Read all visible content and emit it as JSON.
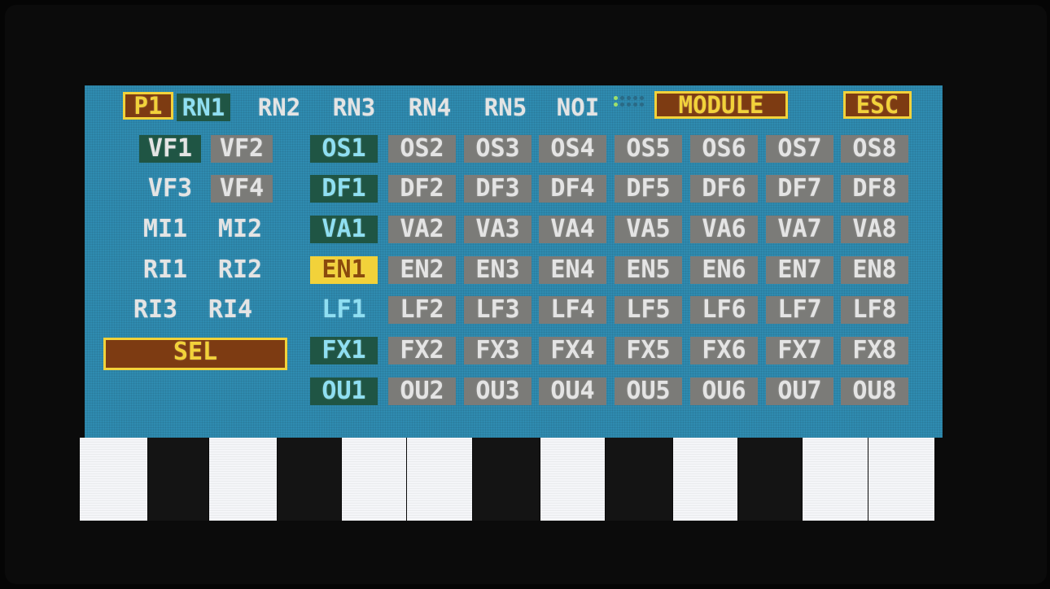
{
  "header": {
    "page": "P1",
    "tabs": [
      "RN1",
      "RN2",
      "RN3",
      "RN4",
      "RN5",
      "NOI"
    ],
    "module_button": "MODULE",
    "esc_button": "ESC"
  },
  "left_grid": [
    [
      "VF1",
      "VF2"
    ],
    [
      "VF3",
      "VF4"
    ],
    [
      "MI1",
      "MI2"
    ],
    [
      "RI1",
      "RI2"
    ],
    [
      "RI3",
      "RI4"
    ]
  ],
  "sel_button": "SEL",
  "module_grid": [
    [
      "OS1",
      "OS2",
      "OS3",
      "OS4",
      "OS5",
      "OS6",
      "OS7",
      "OS8"
    ],
    [
      "DF1",
      "DF2",
      "DF3",
      "DF4",
      "DF5",
      "DF6",
      "DF7",
      "DF8"
    ],
    [
      "VA1",
      "VA2",
      "VA3",
      "VA4",
      "VA5",
      "VA6",
      "VA7",
      "VA8"
    ],
    [
      "EN1",
      "EN2",
      "EN3",
      "EN4",
      "EN5",
      "EN6",
      "EN7",
      "EN8"
    ],
    [
      "LF1",
      "LF2",
      "LF3",
      "LF4",
      "LF5",
      "LF6",
      "LF7",
      "LF8"
    ],
    [
      "FX1",
      "FX2",
      "FX3",
      "FX4",
      "FX5",
      "FX6",
      "FX7",
      "FX8"
    ],
    [
      "OU1",
      "OU2",
      "OU3",
      "OU4",
      "OU5",
      "OU6",
      "OU7",
      "OU8"
    ]
  ],
  "selected_module": "EN1",
  "colors": {
    "screen": "#2f8bb0",
    "cell": "#7b7b78",
    "active": "#1f5544",
    "accent": "#f2d23a",
    "brown": "#7d3b12"
  }
}
